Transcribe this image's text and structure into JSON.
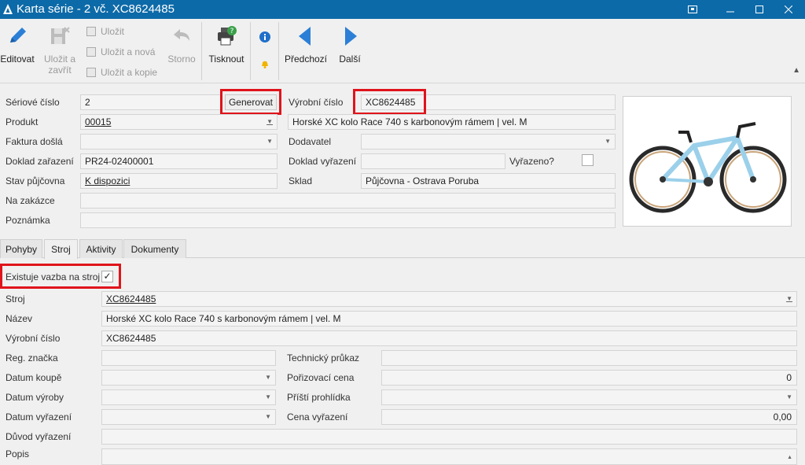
{
  "window": {
    "title": "Karta série - 2 vč. XC8624485"
  },
  "toolbar": {
    "edit": "Editovat",
    "save_close_1": "Uložit a",
    "save_close_2": "zavřít",
    "save": "Uložit",
    "save_new": "Uložit a nová",
    "save_copy": "Uložit a kopie",
    "cancel": "Storno",
    "print": "Tisknout",
    "prev": "Předchozí",
    "next": "Další"
  },
  "form": {
    "serial_label": "Sériové číslo",
    "serial_value": "2",
    "generate": "Generovat",
    "manuf_label": "Výrobní číslo",
    "manuf_value": "XC8624485",
    "product_label": "Produkt",
    "product_value": "00015",
    "product_name": "Horské XC kolo Race 740 s karbonovým rámem | vel. M",
    "invoice_label": "Faktura došlá",
    "invoice_value": "",
    "supplier_label": "Dodavatel",
    "supplier_value": "",
    "doc_in_label": "Doklad zařazení",
    "doc_in_value": "PR24-02400001",
    "doc_out_label": "Doklad vyřazení",
    "doc_out_value": "",
    "discarded_label": "Vyřazeno?",
    "rental_label": "Stav půjčovna",
    "rental_value": "K dispozici",
    "store_label": "Sklad",
    "store_value": "Půjčovna - Ostrava Poruba",
    "order_label": "Na zakázce",
    "order_value": "",
    "note_label": "Poznámka",
    "note_value": ""
  },
  "tabs": [
    "Pohyby",
    "Stroj",
    "Aktivity",
    "Dokumenty"
  ],
  "machine": {
    "exists_label": "Existuje vazba na stroj",
    "exists_checked": "✓",
    "machine_label": "Stroj",
    "machine_value": "XC8624485",
    "name_label": "Název",
    "name_value": "Horské XC kolo Race 740 s karbonovým rámem | vel. M",
    "manuf_label": "Výrobní číslo",
    "manuf_value": "XC8624485",
    "reg_label": "Reg. značka",
    "reg_value": "",
    "tech_label": "Technický průkaz",
    "tech_value": "",
    "buy_date_label": "Datum koupě",
    "buy_price_label": "Pořizovací cena",
    "buy_price_value": "0",
    "prod_date_label": "Datum výroby",
    "next_insp_label": "Příští prohlídka",
    "disc_date_label": "Datum vyřazení",
    "disc_price_label": "Cena vyřazení",
    "disc_price_value": "0,00",
    "disc_reason_label": "Důvod vyřazení",
    "desc_label": "Popis"
  },
  "colors": {
    "titlebar": "#0d6aa8",
    "highlight": "#e0141b",
    "accent_blue": "#2b7fd6"
  }
}
